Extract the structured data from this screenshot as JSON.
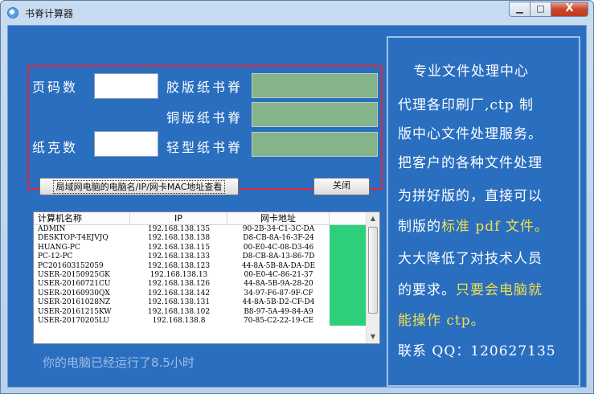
{
  "window": {
    "title": "书脊计算器",
    "btn_min": "▁",
    "btn_max": "□",
    "btn_close": "X"
  },
  "form": {
    "page_count_label": "页码数",
    "gsm_label": "纸克数",
    "glue_spine_label": "胶版纸书脊",
    "coated_spine_label": "铜版纸书脊",
    "light_spine_label": "轻型纸书脊",
    "page_count_value": "",
    "gsm_value": "",
    "glue_spine_value": "",
    "coated_spine_value": "",
    "light_spine_value": ""
  },
  "buttons": {
    "lan_lookup": "局域网电脑的电脑名/IP/网卡MAC地址查看",
    "close": "关闭"
  },
  "list": {
    "columns": [
      "计算机名称",
      "IP",
      "网卡地址"
    ],
    "rows": [
      [
        "ADMIN",
        "192.168.138.135",
        "90-2B-34-C1-3C-DA"
      ],
      [
        "DESKTOP-T4EJVJQ",
        "192.168.138.138",
        "D8-CB-8A-16-3F-24"
      ],
      [
        "HUANG-PC",
        "192.168.138.115",
        "00-E0-4C-08-D3-46"
      ],
      [
        "PC-12-PC",
        "192.168.138.133",
        "D8-CB-8A-13-86-7D"
      ],
      [
        "PC20160315205​9",
        "192.168.138.123",
        "44-8A-5B-8A-DA-DE"
      ],
      [
        "USER-20150925GK",
        "192.168.138.13",
        "00-E0-4C-86-21-37"
      ],
      [
        "USER-20160721CU",
        "192.168.138.126",
        "44-8A-5B-9A-28-20"
      ],
      [
        "USER-20160930QX",
        "192.168.138.142",
        "34-97-F6-87-9F-CF"
      ],
      [
        "USER-20161028NZ",
        "192.168.138.131",
        "44-8A-5B-D2-CF-D4"
      ],
      [
        "USER-20161215KW",
        "192.168.138.102",
        "B8-97-5A-49-84-A9"
      ],
      [
        "USER-20170205LU",
        "192.168.138.8",
        "70-85-C2-22-19-CE"
      ]
    ]
  },
  "status": "你的电脑已经运行了8.5小时",
  "ad": {
    "line1": "专业文件处理中心",
    "line2": "代理各印刷厂,ctp 制",
    "line3": "版中心文件处理服务。",
    "line4": "把客户的各种文件处理",
    "line5": "为拼好版的，直接可以",
    "line6_pre": "制版的",
    "line6_hl": "标准 pdf 文件。",
    "line7": "大大降低了对技术人员",
    "line8_pre": "的要求。",
    "line8_hl": "只要会电脑就",
    "line9_hl": "能操作 ctp。",
    "line10": "联系 QQ：120627135"
  }
}
